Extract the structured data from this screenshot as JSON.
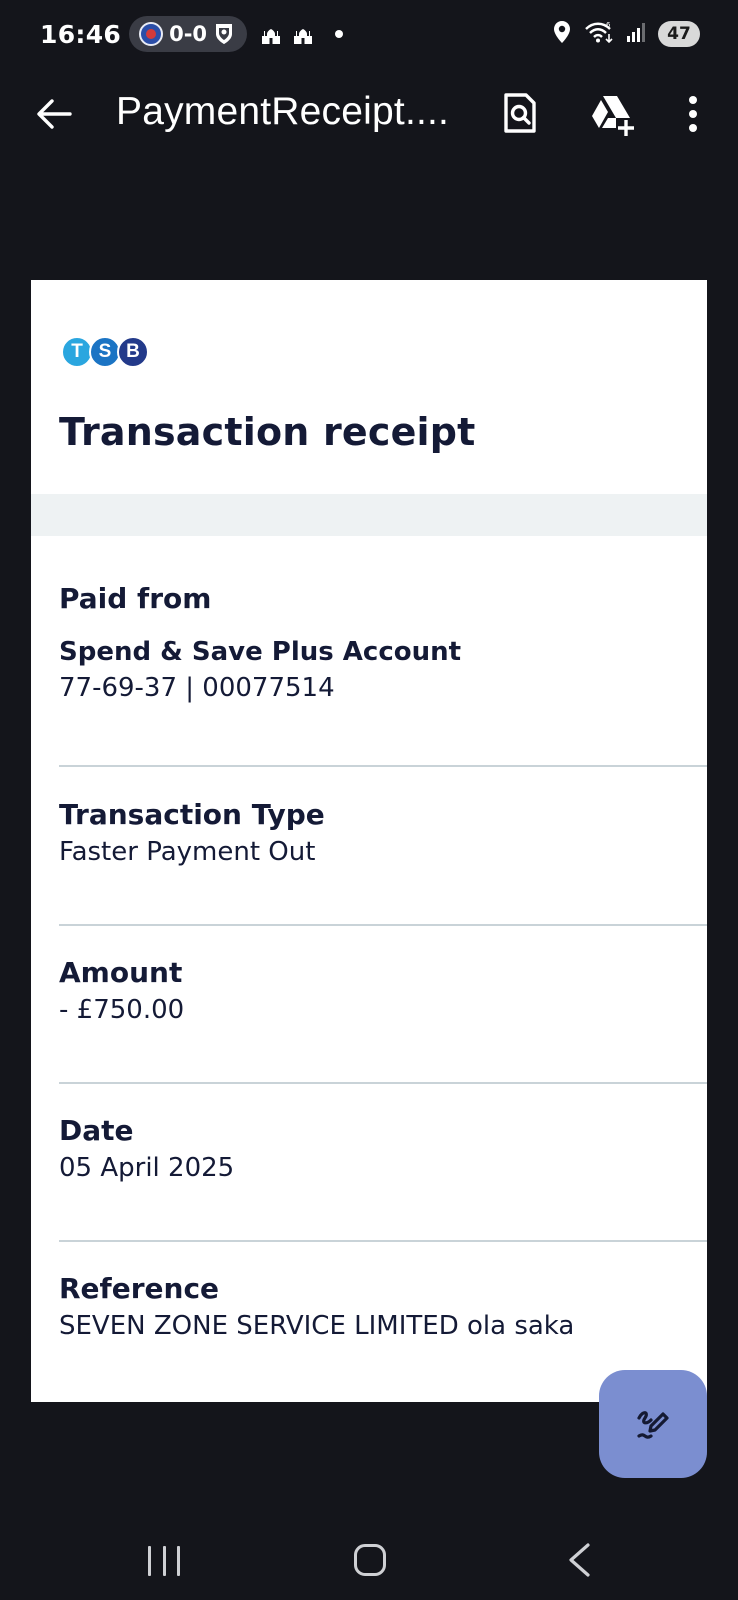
{
  "status_bar": {
    "time": "16:46",
    "score": "0-0",
    "battery": "47",
    "icons": [
      "team-badge-icon",
      "team-badge-icon",
      "mosque-icon",
      "mosque-icon",
      "dot-icon",
      "location-icon",
      "wifi-icon",
      "signal-icon",
      "battery-icon"
    ]
  },
  "app_bar": {
    "title": "PaymentReceipt....",
    "icons": [
      "back-arrow-icon",
      "search-document-icon",
      "drive-add-icon",
      "more-vert-icon"
    ]
  },
  "document": {
    "logo_letters": [
      "T",
      "S",
      "B"
    ],
    "logo_colors": [
      "#2aa6df",
      "#1b74c4",
      "#233a8a"
    ],
    "title": "Transaction receipt",
    "paid_from": {
      "heading": "Paid from",
      "account_name": "Spend & Save Plus Account",
      "account_details": "77-69-37 | 00077514"
    },
    "transaction_type": {
      "heading": "Transaction Type",
      "value": "Faster Payment Out"
    },
    "amount": {
      "heading": "Amount",
      "value": "- £750.00"
    },
    "date": {
      "heading": "Date",
      "value": "05 April 2025"
    },
    "reference": {
      "heading": "Reference",
      "value": "SEVEN ZONE SERVICE LIMITED ola saka"
    }
  },
  "fab": {
    "icon": "edit-sign-icon",
    "color": "#7b8ed0"
  },
  "nav_bar": {
    "icons": [
      "recents-icon",
      "home-icon",
      "back-icon"
    ]
  }
}
